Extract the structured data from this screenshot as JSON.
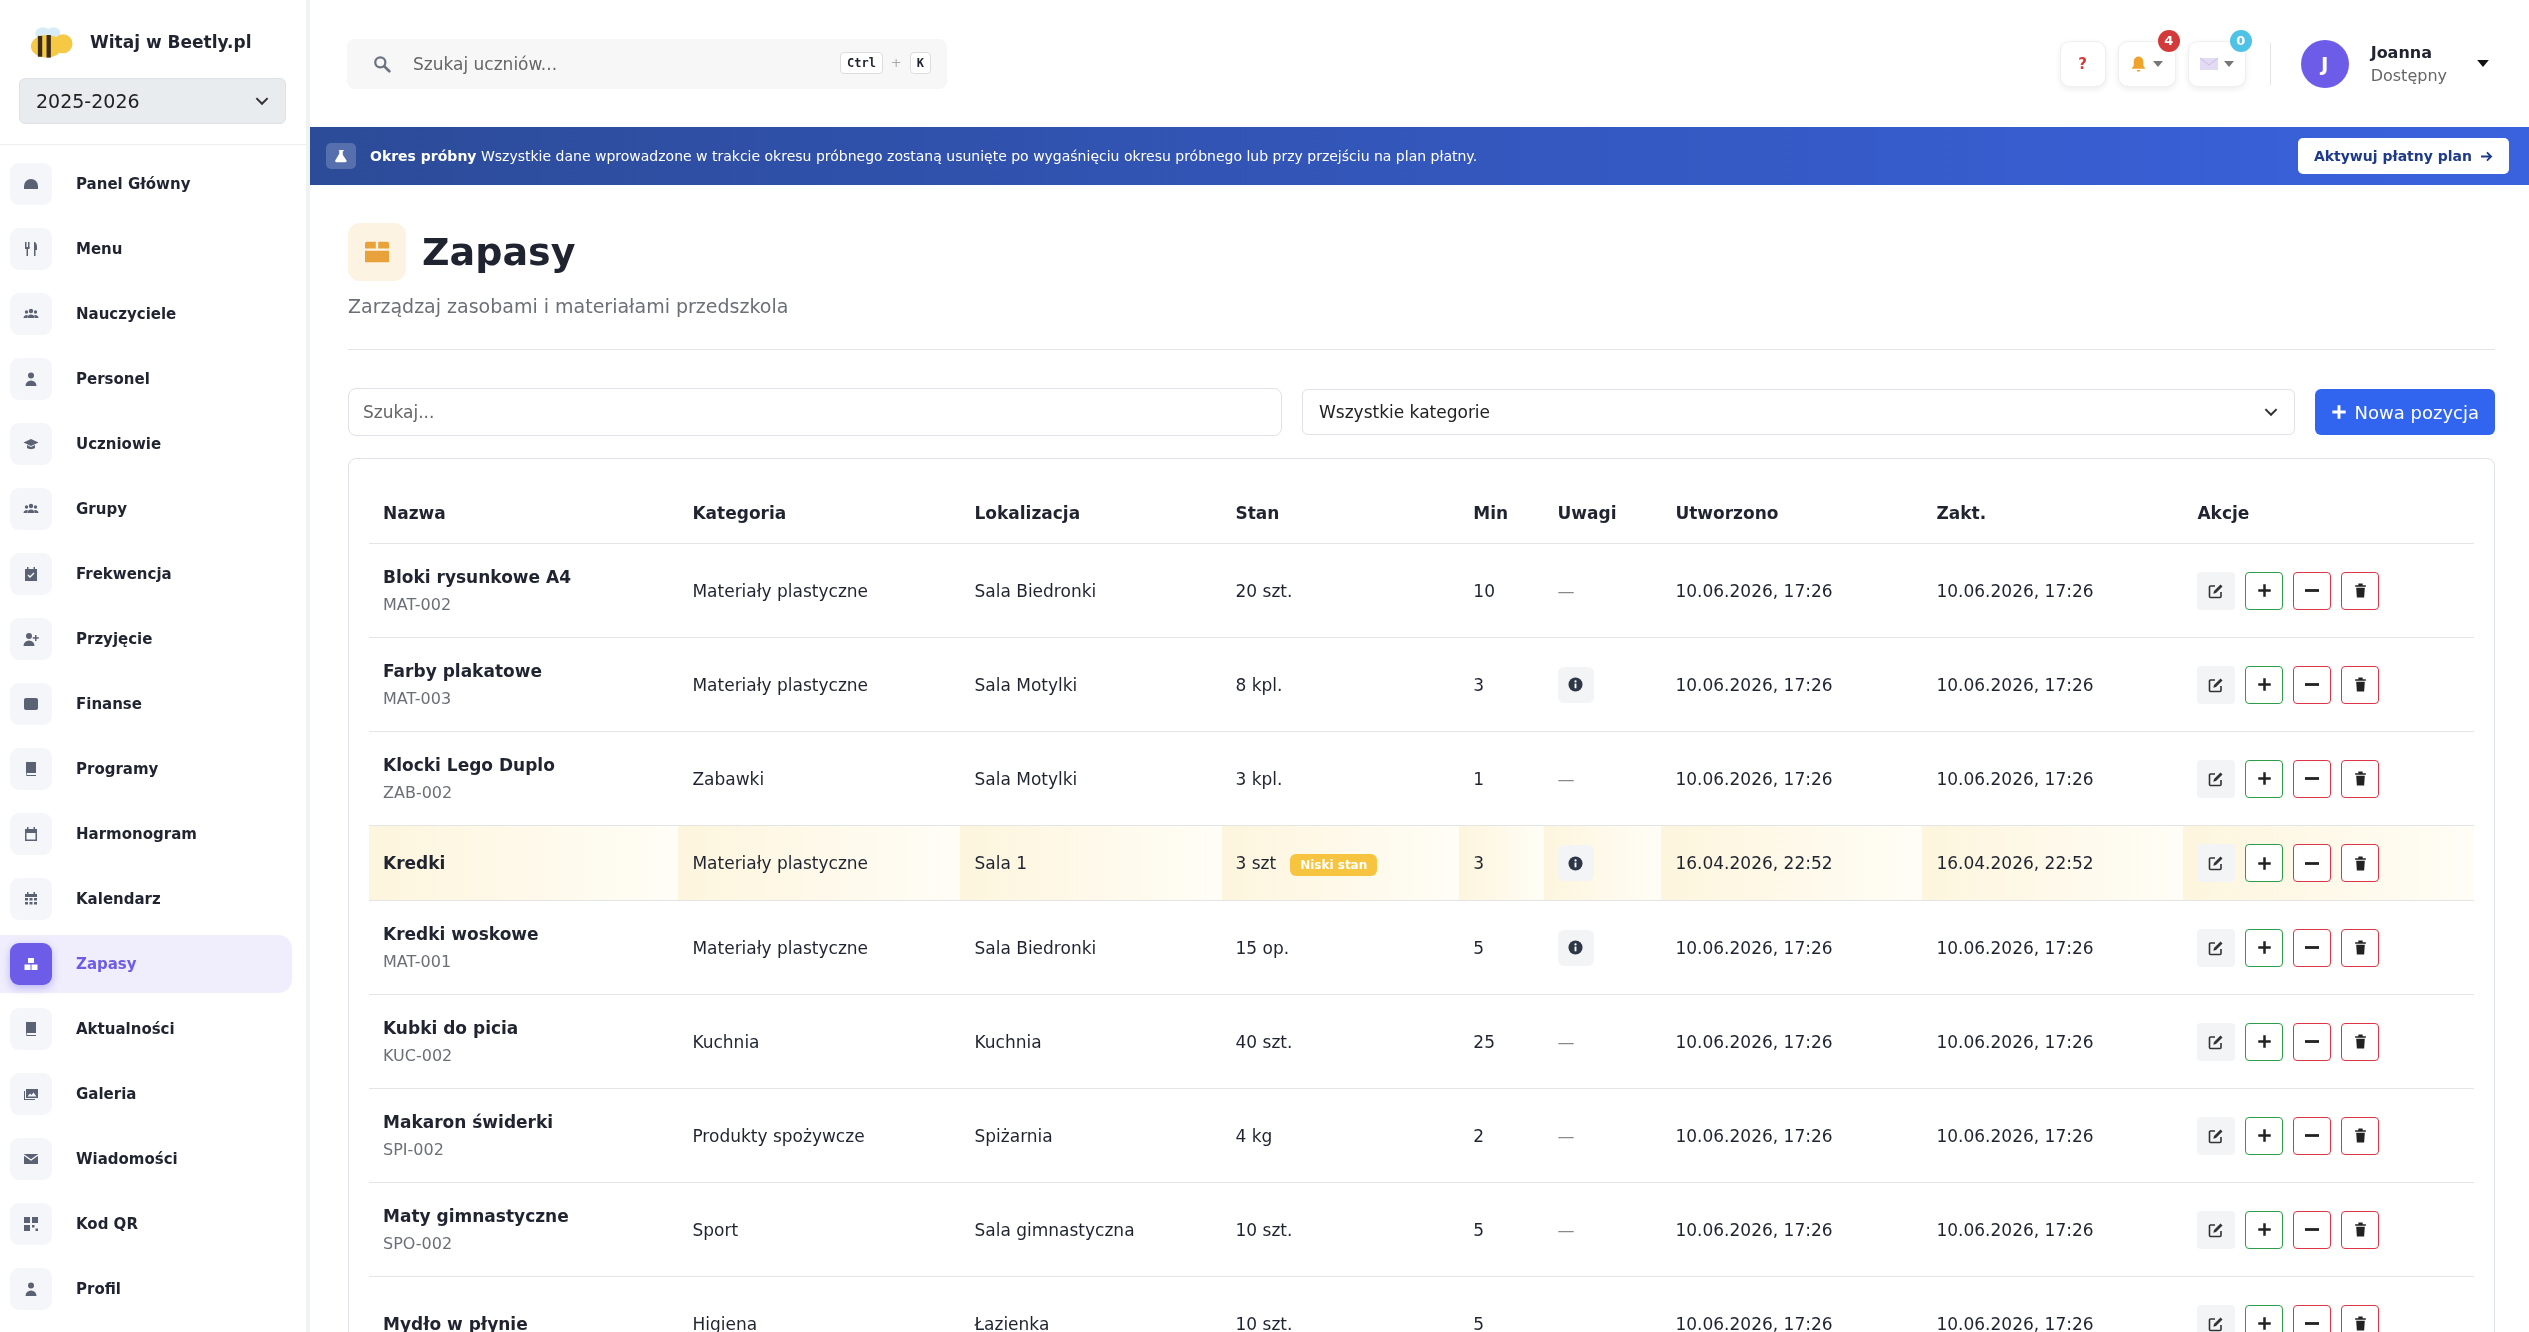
{
  "sidebar": {
    "greeting": "Witaj w Beetly.pl",
    "year": "2025-2026",
    "items": [
      {
        "label": "Panel Główny",
        "selected": false
      },
      {
        "label": "Menu",
        "selected": false
      },
      {
        "label": "Nauczyciele",
        "selected": false
      },
      {
        "label": "Personel",
        "selected": false
      },
      {
        "label": "Uczniowie",
        "selected": false
      },
      {
        "label": "Grupy",
        "selected": false
      },
      {
        "label": "Frekwencja",
        "selected": false
      },
      {
        "label": "Przyjęcie",
        "selected": false
      },
      {
        "label": "Finanse",
        "selected": false
      },
      {
        "label": "Programy",
        "selected": false
      },
      {
        "label": "Harmonogram",
        "selected": false
      },
      {
        "label": "Kalendarz",
        "selected": false
      },
      {
        "label": "Zapasy",
        "selected": true
      },
      {
        "label": "Aktualności",
        "selected": false
      },
      {
        "label": "Galeria",
        "selected": false
      },
      {
        "label": "Wiadomości",
        "selected": false
      },
      {
        "label": "Kod QR",
        "selected": false
      },
      {
        "label": "Profil",
        "selected": false
      }
    ]
  },
  "header": {
    "search_placeholder": "Szukaj uczniów...",
    "shortcut_keys": [
      "Ctrl",
      "K"
    ],
    "key_joiner": "+",
    "help": "?",
    "notifications_count": "4",
    "messages_count": "0",
    "user": {
      "initial": "J",
      "name": "Joanna",
      "status": "Dostępny"
    }
  },
  "banner": {
    "title": "Okres próbny",
    "text": "Wszystkie dane wprowadzone w trakcie okresu próbnego zostaną usunięte po wygaśnięciu okresu próbnego lub przy przejściu na plan płatny.",
    "button": "Aktywuj płatny plan"
  },
  "page": {
    "title": "Zapasy",
    "subtitle": "Zarządzaj zasobami i materiałami przedszkola"
  },
  "filters": {
    "search_placeholder": "Szukaj...",
    "category": "Wszystkie kategorie",
    "new_button": "Nowa pozycja"
  },
  "table": {
    "columns": [
      "Nazwa",
      "Kategoria",
      "Lokalizacja",
      "Stan",
      "Min",
      "Uwagi",
      "Utworzono",
      "Zakt.",
      "Akcje"
    ],
    "rows": [
      {
        "name": "Bloki rysunkowe A4",
        "code": "MAT-002",
        "category": "Materiały plastyczne",
        "location": "Sala Biedronki",
        "stock": "20 szt.",
        "low_stock": false,
        "min": "10",
        "note": {
          "kind": "text",
          "text": "—"
        },
        "created": "10.06.2026, 17:26",
        "updated": "10.06.2026, 17:26"
      },
      {
        "name": "Farby plakatowe",
        "code": "MAT-003",
        "category": "Materiały plastyczne",
        "location": "Sala Motylki",
        "stock": "8 kpl.",
        "low_stock": false,
        "min": "3",
        "note": {
          "kind": "icon"
        },
        "created": "10.06.2026, 17:26",
        "updated": "10.06.2026, 17:26"
      },
      {
        "name": "Klocki Lego Duplo",
        "code": "ZAB-002",
        "category": "Zabawki",
        "location": "Sala Motylki",
        "stock": "3 kpl.",
        "low_stock": false,
        "min": "1",
        "note": {
          "kind": "text",
          "text": "—"
        },
        "created": "10.06.2026, 17:26",
        "updated": "10.06.2026, 17:26"
      },
      {
        "name": "Kredki",
        "category": "Materiały plastyczne",
        "location": "Sala 1",
        "stock": "3 szt",
        "low_stock": true,
        "badge": "Niski stan",
        "min": "3",
        "note": {
          "kind": "icon"
        },
        "created": "16.04.2026, 22:52",
        "updated": "16.04.2026, 22:52"
      },
      {
        "name": "Kredki woskowe",
        "code": "MAT-001",
        "category": "Materiały plastyczne",
        "location": "Sala Biedronki",
        "stock": "15 op.",
        "low_stock": false,
        "min": "5",
        "note": {
          "kind": "icon"
        },
        "created": "10.06.2026, 17:26",
        "updated": "10.06.2026, 17:26"
      },
      {
        "name": "Kubki do picia",
        "code": "KUC-002",
        "category": "Kuchnia",
        "location": "Kuchnia",
        "stock": "40 szt.",
        "low_stock": false,
        "min": "25",
        "note": {
          "kind": "text",
          "text": "—"
        },
        "created": "10.06.2026, 17:26",
        "updated": "10.06.2026, 17:26"
      },
      {
        "name": "Makaron świderki",
        "code": "SPI-002",
        "category": "Produkty spożywcze",
        "location": "Spiżarnia",
        "stock": "4 kg",
        "low_stock": false,
        "min": "2",
        "note": {
          "kind": "text",
          "text": "—"
        },
        "created": "10.06.2026, 17:26",
        "updated": "10.06.2026, 17:26"
      },
      {
        "name": "Maty gimnastyczne",
        "code": "SPO-002",
        "category": "Sport",
        "location": "Sala gimnastyczna",
        "stock": "10 szt.",
        "low_stock": false,
        "min": "5",
        "note": {
          "kind": "text",
          "text": "—"
        },
        "created": "10.06.2026, 17:26",
        "updated": "10.06.2026, 17:26"
      },
      {
        "name": "Mydło w płynie",
        "category": "Higiena",
        "location": "Łazienka",
        "stock": "10 szt.",
        "low_stock": false,
        "min": "5",
        "created": "10.06.2026, 17:26",
        "updated": "10.06.2026, 17:26"
      }
    ]
  }
}
